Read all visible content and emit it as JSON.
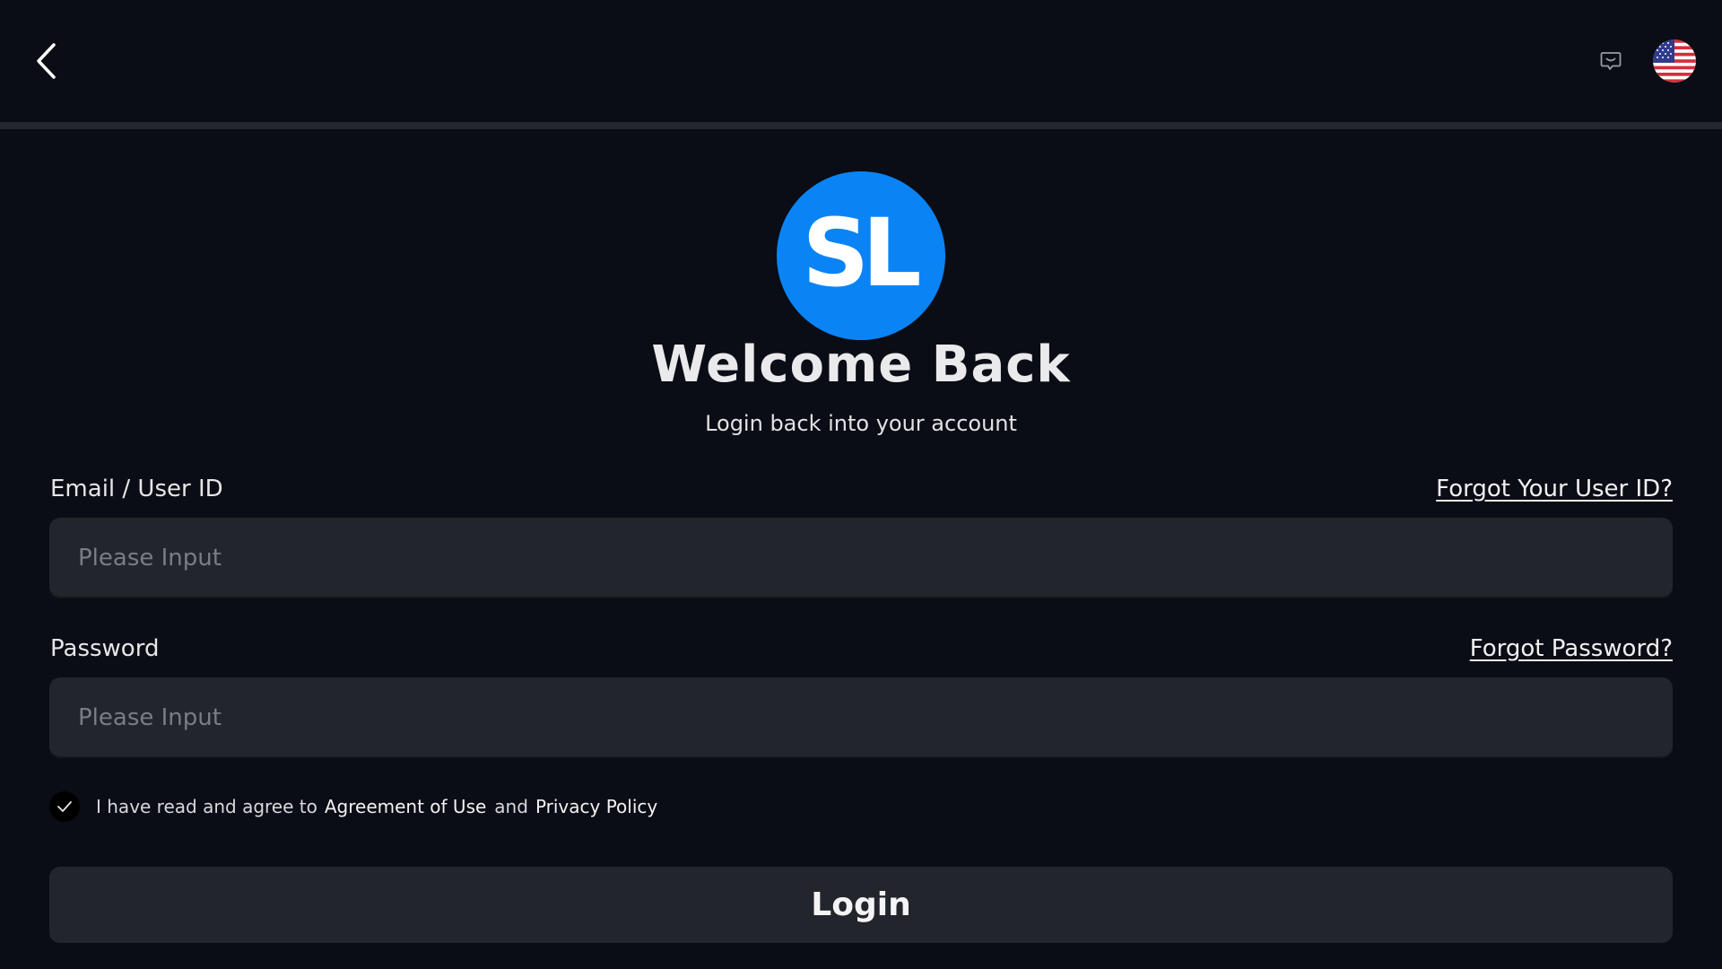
{
  "header": {
    "back_icon": "chevron-left-icon",
    "chat_icon": "message-icon",
    "language_flag": "us-flag-icon"
  },
  "brand": {
    "logo_text": "SL",
    "logo_color": "#0a84f5"
  },
  "hero": {
    "title": "Welcome Back",
    "subtitle": "Login back into your account"
  },
  "form": {
    "email": {
      "label": "Email / User ID",
      "link": "Forgot Your User ID?",
      "placeholder": "Please Input",
      "value": ""
    },
    "password": {
      "label": "Password",
      "link": "Forgot Password?",
      "placeholder": "Please Input",
      "value": ""
    },
    "agreement": {
      "checked": true,
      "text": "I have read and agree to",
      "terms_link": "Agreement of Use",
      "conjunction": "and",
      "privacy_link": "Privacy Policy"
    },
    "submit_label": "Login"
  },
  "colors": {
    "background": "#0a0d15",
    "surface": "#23252c",
    "accent": "#0a84f5"
  }
}
